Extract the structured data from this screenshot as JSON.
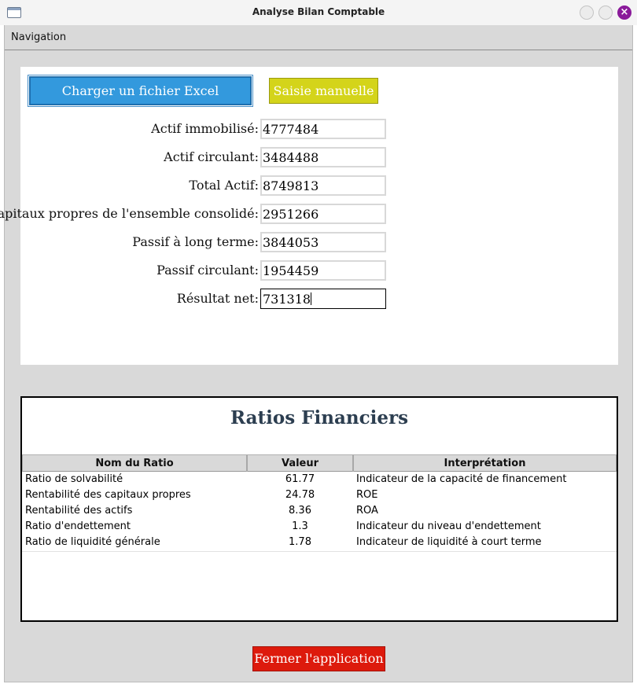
{
  "window": {
    "title": "Analyse Bilan Comptable",
    "close_glyph": "×"
  },
  "menubar": {
    "items": [
      "Navigation"
    ]
  },
  "actions": {
    "load_excel_label": "Charger un fichier Excel",
    "manual_entry_label": "Saisie manuelle",
    "close_app_label": "Fermer l'application"
  },
  "form": {
    "fields": [
      {
        "label": "Actif immobilisé:",
        "value": "4777484"
      },
      {
        "label": "Actif circulant:",
        "value": "3484488"
      },
      {
        "label": "Total Actif:",
        "value": "8749813"
      },
      {
        "label": "Capitaux propres de l'ensemble consolidé:",
        "value": "2951266"
      },
      {
        "label": "Passif à long terme:",
        "value": "3844053"
      },
      {
        "label": "Passif circulant:",
        "value": "1954459"
      },
      {
        "label": "Résultat net:",
        "value": "731318"
      }
    ]
  },
  "ratios": {
    "title": "Ratios Financiers",
    "columns": [
      "Nom du Ratio",
      "Valeur",
      "Interprétation"
    ],
    "rows": [
      [
        "Ratio de solvabilité",
        "61.77",
        "Indicateur de la capacité de financement"
      ],
      [
        "Rentabilité des capitaux propres",
        "24.78",
        "ROE"
      ],
      [
        "Rentabilité des actifs",
        "8.36",
        "ROA"
      ],
      [
        "Ratio d'endettement",
        "1.3",
        "Indicateur du niveau d'endettement"
      ],
      [
        "Ratio de liquidité générale",
        "1.78",
        "Indicateur de liquidité à court terme"
      ]
    ]
  },
  "colors": {
    "excel_button": "#3399dd",
    "manual_button": "#d4d41a",
    "close_button": "#dd1a0c",
    "title_text": "#2c3e50",
    "window_close": "#8a1a9a"
  },
  "icons": {
    "app": "window-icon",
    "close": "close-icon"
  }
}
